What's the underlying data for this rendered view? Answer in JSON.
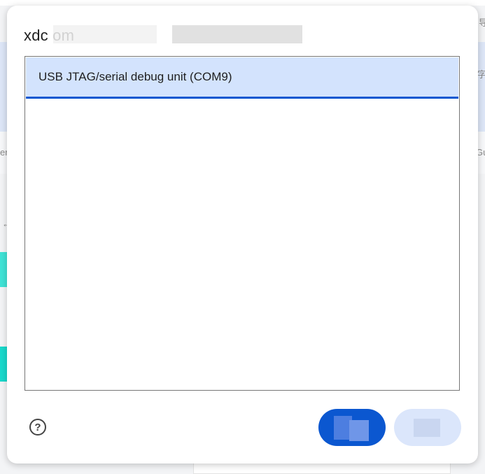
{
  "dialog": {
    "title": "xdc        om",
    "devices": [
      {
        "label": "USB JTAG/serial debug unit (COM9)",
        "selected": true
      }
    ],
    "help_icon": "question-circle-icon",
    "connect_label": "",
    "cancel_label": ""
  },
  "background": {
    "chars": [
      "导",
      "字",
      "er",
      "Gu",
      "←"
    ]
  },
  "colors": {
    "accent": "#0b57d0",
    "selected_bg": "#d3e3fd",
    "secondary_button_bg": "#dbe6fb"
  }
}
